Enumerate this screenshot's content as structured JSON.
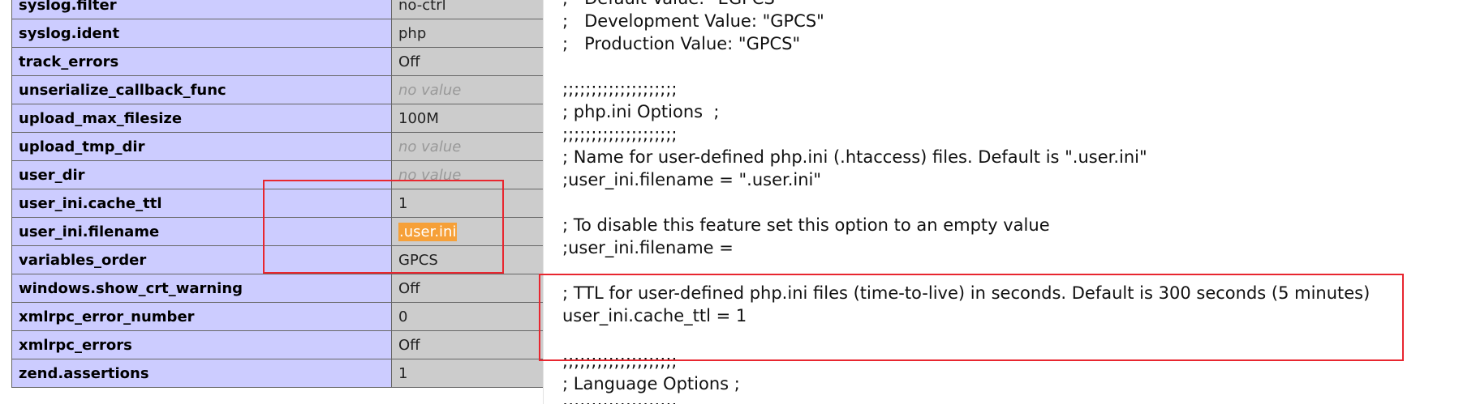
{
  "directives": [
    {
      "name": "syslog.filter",
      "value": "no-ctrl"
    },
    {
      "name": "syslog.ident",
      "value": "php"
    },
    {
      "name": "track_errors",
      "value": "Off"
    },
    {
      "name": "unserialize_callback_func",
      "value": "no value",
      "no_value": true
    },
    {
      "name": "upload_max_filesize",
      "value": "100M"
    },
    {
      "name": "upload_tmp_dir",
      "value": "no value",
      "no_value": true
    },
    {
      "name": "user_dir",
      "value": "no value",
      "no_value": true
    },
    {
      "name": "user_ini.cache_ttl",
      "value": "1"
    },
    {
      "name": "user_ini.filename",
      "value": ".user.ini",
      "highlighted": true
    },
    {
      "name": "variables_order",
      "value": "GPCS"
    },
    {
      "name": "windows.show_crt_warning",
      "value": "Off"
    },
    {
      "name": "xmlrpc_error_number",
      "value": "0"
    },
    {
      "name": "xmlrpc_errors",
      "value": "Off"
    },
    {
      "name": "zend.assertions",
      "value": "1"
    }
  ],
  "ini_lines": [
    ";   Default Value: \"EGPCS\"",
    ";   Development Value: \"GPCS\"",
    ";   Production Value: \"GPCS\"",
    "",
    ";;;;;;;;;;;;;;;;;;;;",
    "; php.ini Options  ;",
    ";;;;;;;;;;;;;;;;;;;;",
    "; Name for user-defined php.ini (.htaccess) files. Default is \".user.ini\"",
    ";user_ini.filename = \".user.ini\"",
    "",
    "; To disable this feature set this option to an empty value",
    ";user_ini.filename =",
    "",
    "; TTL for user-defined php.ini files (time-to-live) in seconds. Default is 300 seconds (5 minutes)",
    "user_ini.cache_ttl = 1",
    "",
    ";;;;;;;;;;;;;;;;;;;;",
    "; Language Options ;",
    ";;;;;;;;;;;;;;;;;;;;"
  ],
  "colors": {
    "key_bg": "#ccccff",
    "value_bg": "#cccccc",
    "highlight": "#f6a038",
    "annotation": "#e8262f"
  }
}
